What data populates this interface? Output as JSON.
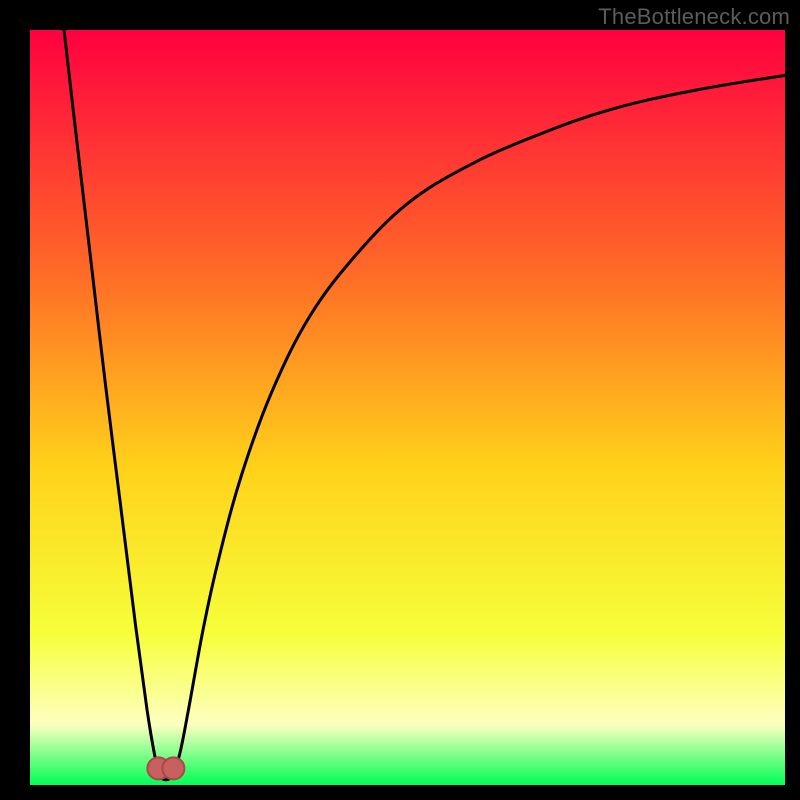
{
  "watermark": "TheBottleneck.com",
  "colors": {
    "frame": "#000000",
    "grad_top": "#ff0040",
    "grad_mid_high": "#ff6a27",
    "grad_mid": "#ffd21a",
    "grad_low": "#f6ff3a",
    "grad_pale": "#fdffc0",
    "grad_bottom": "#00ff55",
    "curve": "#000000",
    "marker_fill": "#c96060",
    "marker_stroke": "#a84848"
  },
  "chart_data": {
    "type": "line",
    "title": "",
    "xlabel": "",
    "ylabel": "",
    "xlim": [
      0,
      100
    ],
    "ylim": [
      0,
      100
    ],
    "series": [
      {
        "name": "curve",
        "x": [
          4.5,
          6,
          8,
          10,
          12,
          14,
          15.5,
          16.5,
          17.2,
          18,
          18.8,
          19.8,
          21,
          23,
          25,
          28,
          32,
          37,
          43,
          50,
          58,
          67,
          77,
          88,
          100
        ],
        "y": [
          100,
          87,
          70,
          53,
          37,
          21,
          10,
          4,
          1.3,
          0.7,
          1.3,
          4,
          10,
          21,
          30,
          41,
          52,
          62,
          70,
          77,
          82,
          86,
          89.5,
          92,
          94
        ]
      }
    ],
    "markers": [
      {
        "name": "low-point-left",
        "x": 17.0,
        "y": 2.2
      },
      {
        "name": "low-point-right",
        "x": 19.0,
        "y": 2.2
      }
    ],
    "notes": "Axes carry no visible tick labels; x/y in percent of plot width/height. Curve dips to ~0 around x≈18 then rises asymptotically toward ~94."
  }
}
